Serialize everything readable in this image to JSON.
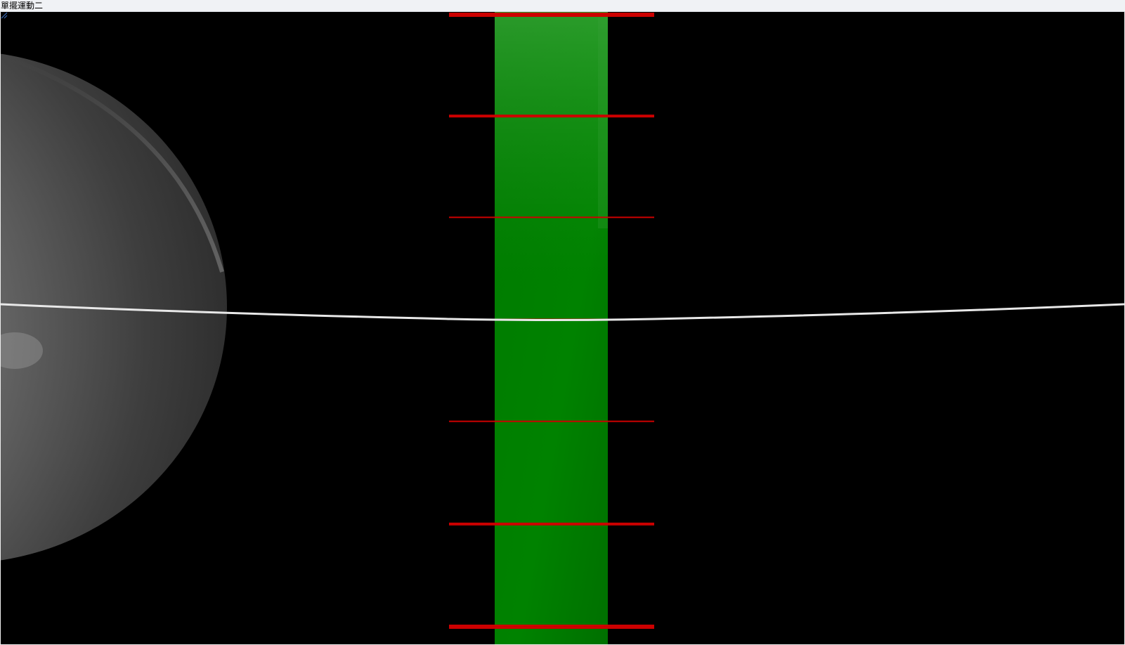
{
  "window": {
    "title": "單擺運動二"
  },
  "scene": {
    "background_color": "#000000",
    "pendulum_bob_color": "#8a8a8a",
    "string_color": "#ffffff",
    "ruler_color": "#008000",
    "tick_color": "#cc0000",
    "tick_count": 7
  },
  "icons": {
    "resize_grip": "resize-grip-icon"
  }
}
